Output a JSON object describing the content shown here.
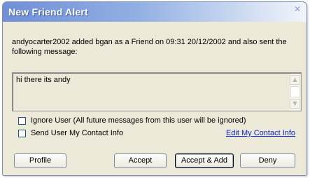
{
  "window": {
    "title": "New Friend Alert"
  },
  "intro_text": "andyocarter2002 added bgan as a Friend on 09:31 20/12/2002 and also sent the following message:",
  "message": {
    "text": "hi there its andy"
  },
  "options": {
    "ignore_user_label": "Ignore User (All future messages from this user will be ignored)",
    "ignore_user_checked": false,
    "send_contact_label": "Send User My Contact Info",
    "send_contact_checked": false,
    "edit_contact_link": "Edit My Contact Info"
  },
  "buttons": {
    "profile": "Profile",
    "accept": "Accept",
    "accept_add": "Accept & Add",
    "deny": "Deny"
  },
  "icons": {
    "scroll_up": "triangle-up-icon",
    "scroll_down": "triangle-down-icon"
  },
  "colors": {
    "titlebar_start": "#6f8ed7",
    "titlebar_end": "#f2f5fb",
    "dialog_background": "#ece9d8",
    "link": "#0a24c9"
  }
}
